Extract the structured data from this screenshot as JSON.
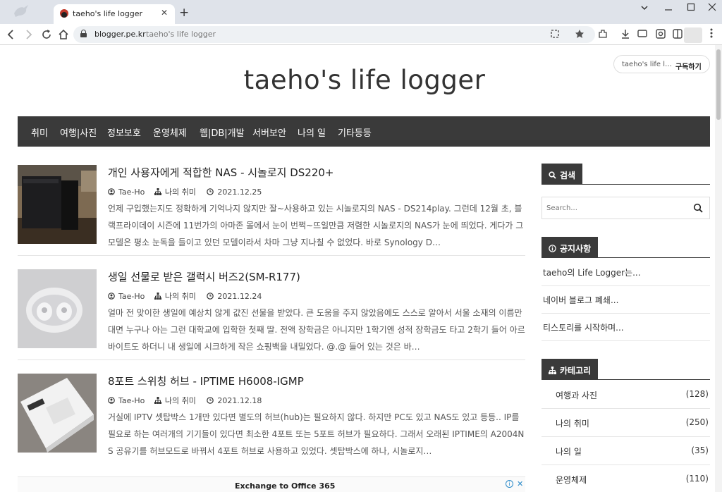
{
  "browser": {
    "tab_title": "taeho's life logger",
    "tab_close": "✕",
    "new_tab": "+",
    "host": "blogger.pe.kr",
    "path": "taeho's life logger"
  },
  "blog": {
    "title": "taeho's life logger",
    "subscribe_name": "taeho's life l…",
    "subscribe_label": "구독하기"
  },
  "nav": [
    "취미",
    "여행|사진",
    "정보보호",
    "운영체제",
    "웹|DB|개발",
    "서버보안",
    "나의 일",
    "기타등등"
  ],
  "posts": [
    {
      "title": "개인 사용자에게 적합한 NAS - 시놀로지 DS220+",
      "author": "Tae-Ho",
      "category": "나의 취미",
      "date": "2021.12.25",
      "excerpt": "언제 구입했는지도 정확하게 기억나지 않지만 잘~사용하고 있는 시놀로지의 NAS - DS214play. 그런데 12월 초, 블랙프라이데이 시즌에 11번가의 아마존 몰에서 눈이 번쩍~뜨일만큼 저렴한 시놀로지의 NAS가 눈에 띄었다. 게다가 그 모델은 평소 눈독을 들이고 있던 모델이라서 차마 그냥 지나칠 수 없었다. 바로 Synology D…"
    },
    {
      "title": "생일 선물로 받은 갤럭시 버즈2(SM-R177)",
      "author": "Tae-Ho",
      "category": "나의 취미",
      "date": "2021.12.24",
      "excerpt": "얼마 전 맞이한 생일에 예상치 않게 값진 선물을 받았다. 큰 도움을 주지 않았음에도 스스로 알아서 서울 소재의 이름만 대면 누구나 아는 그런 대학교에 입학한 첫째 딸. 전액 장학금은 아니지만 1학기엔 성적 장학금도 타고 2학기 들어 아르바이트도 하더니 내 생일에 시크하게 작은 쇼핑백을 내밀었다. @.@ 들어 있는 것은 바…"
    },
    {
      "title": "8포트 스위칭 허브 - IPTIME H6008-IGMP",
      "author": "Tae-Ho",
      "category": "나의 취미",
      "date": "2021.12.18",
      "excerpt": "거실에 IPTV 셋탑박스 1개만 있다면 별도의 허브(hub)는 필요하지 않다. 하지만 PC도 있고 NAS도 있고 등등.. IP를 필요로 하는 여러개의 기기들이 있다면 최소한 4포트 또는 5포트 허브가 필요하다. 그래서 오래된 IPTIME의 A2004NS 공유기를 허브모드로 바꿔서 4포트 허브로 사용하고 있었다. 셋탑박스에 하나, 시놀로지…"
    }
  ],
  "sidebar": {
    "search_title": "검색",
    "search_placeholder": "Search...",
    "notice_title": "공지사항",
    "notices": [
      "taeho의 Life Logger는...",
      "네이버 블로그 폐쇄...",
      "티스토리를 시작하며..."
    ],
    "category_title": "카테고리",
    "categories": [
      {
        "name": "여행과 사진",
        "count": "(128)"
      },
      {
        "name": "나의 취미",
        "count": "(250)"
      },
      {
        "name": "나의 일",
        "count": "(35)"
      },
      {
        "name": "운영체제",
        "count": "(110)"
      }
    ]
  },
  "ad": {
    "text": "Exchange to Office 365",
    "info": "i",
    "close": "✕"
  },
  "icons": {
    "back": "arrow-left-icon",
    "forward": "arrow-right-icon",
    "reload": "reload-icon",
    "home": "home-icon",
    "lock": "lock-icon",
    "search": "search-icon",
    "user": "user-icon",
    "sitemap": "sitemap-icon",
    "clock": "clock-icon",
    "info": "info-circle-icon"
  }
}
